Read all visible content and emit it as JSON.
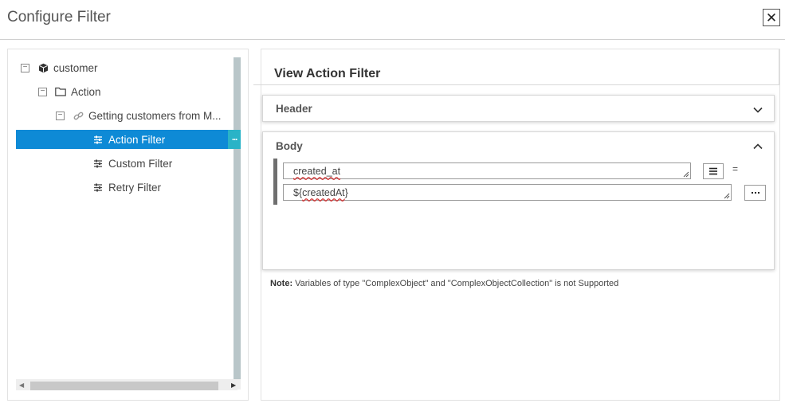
{
  "dialog": {
    "title": "Configure Filter",
    "close_icon": "close-icon"
  },
  "tree": {
    "items": [
      {
        "label": "customer",
        "icon": "cube-icon",
        "expanded": true
      },
      {
        "label": "Action",
        "icon": "folder-icon",
        "expanded": true
      },
      {
        "label": "Getting customers from M...",
        "icon": "link-icon",
        "expanded": true
      },
      {
        "label": "Action Filter",
        "icon": "filter-sliders-icon",
        "selected": true
      },
      {
        "label": "Custom Filter",
        "icon": "filter-sliders-icon"
      },
      {
        "label": "Retry Filter",
        "icon": "filter-sliders-icon"
      }
    ],
    "toggle_symbol": "−"
  },
  "view": {
    "title": "View Action Filter",
    "header_section": {
      "label": "Header",
      "state": "collapsed"
    },
    "body_section": {
      "label": "Body",
      "state": "expanded",
      "key_field": {
        "value": "created_at"
      },
      "operator": "=",
      "value_field": {
        "prefix": "${",
        "word": "createdAt",
        "suffix": "}"
      }
    },
    "note_label": "Note:",
    "note_text": " Variables of type \"ComplexObject\" and \"ComplexObjectCollection\" is not Supported"
  },
  "colors": {
    "selected_row": "#0e8ad6",
    "handle": "#2ab3c7",
    "scroll_thumb": "#b9c6c9"
  }
}
